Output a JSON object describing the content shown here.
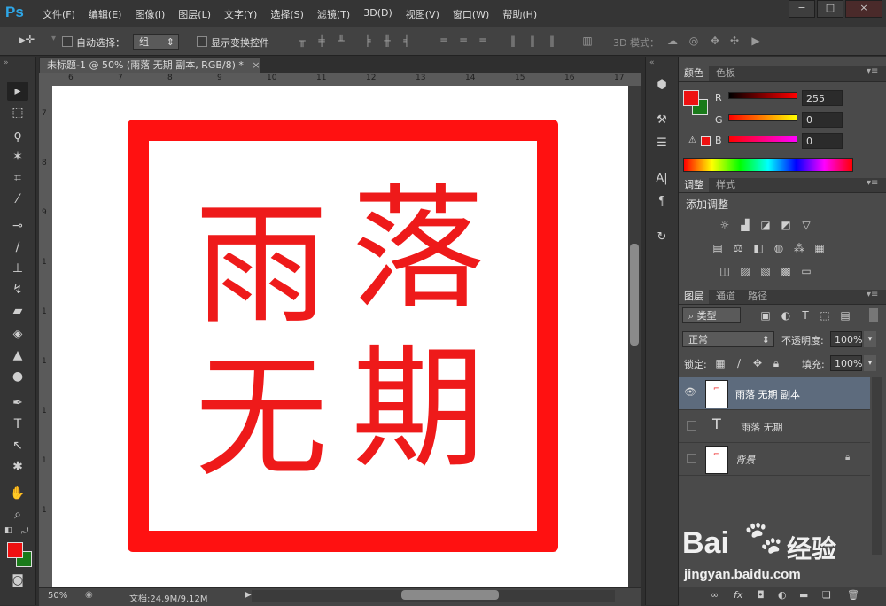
{
  "app": {
    "logo": "Ps"
  },
  "menu": [
    "文件(F)",
    "编辑(E)",
    "图像(I)",
    "图层(L)",
    "文字(Y)",
    "选择(S)",
    "滤镜(T)",
    "3D(D)",
    "视图(V)",
    "窗口(W)",
    "帮助(H)"
  ],
  "window_buttons": {
    "minimize": "−",
    "restore": "□",
    "close": "×"
  },
  "options": {
    "auto_select_label": "自动选择：",
    "auto_select_value": "组",
    "show_transform_label": "显示变换控件",
    "mode_3d_label": "3D 模式："
  },
  "document": {
    "tab_title": "未标题-1 @ 50% (雨落 无期 副本, RGB/8) *",
    "close": "×",
    "glyphs": [
      "雨",
      "落",
      "无",
      "期"
    ],
    "zoom": "50%",
    "doc_size": "文档:24.9M/9.12M",
    "ruler_top": [
      "6",
      "7",
      "8",
      "9",
      "10",
      "11",
      "12",
      "13",
      "14",
      "15",
      "16",
      "17"
    ],
    "ruler_left": [
      "7",
      "8",
      "9",
      "1",
      "1",
      "1",
      "1",
      "1",
      "1"
    ]
  },
  "color_panel": {
    "tabs": [
      "颜色",
      "色板"
    ],
    "r_label": "R",
    "g_label": "G",
    "b_label": "B",
    "r": "255",
    "g": "0",
    "b": "0",
    "foreground": "#ee1111",
    "background": "#1a7a1a"
  },
  "adjust_panel": {
    "tabs": [
      "调整",
      "样式"
    ],
    "title": "添加调整"
  },
  "layers_panel": {
    "tabs": [
      "图层",
      "通道",
      "路径"
    ],
    "filter_kind": "类型",
    "blend_mode": "正常",
    "opacity_label": "不透明度:",
    "opacity": "100%",
    "lock_label": "锁定:",
    "fill_label": "填充:",
    "fill": "100%",
    "layers": [
      {
        "name": "雨落 无期 副本",
        "selected": true,
        "visible": true
      },
      {
        "name": "雨落 无期",
        "selected": false,
        "visible": false,
        "type": "text"
      },
      {
        "name": "背景",
        "selected": false,
        "visible": false,
        "locked": true
      }
    ]
  },
  "watermark": {
    "brand": "Bai",
    "brand2": "经验",
    "url": "jingyan.baidu.com"
  }
}
